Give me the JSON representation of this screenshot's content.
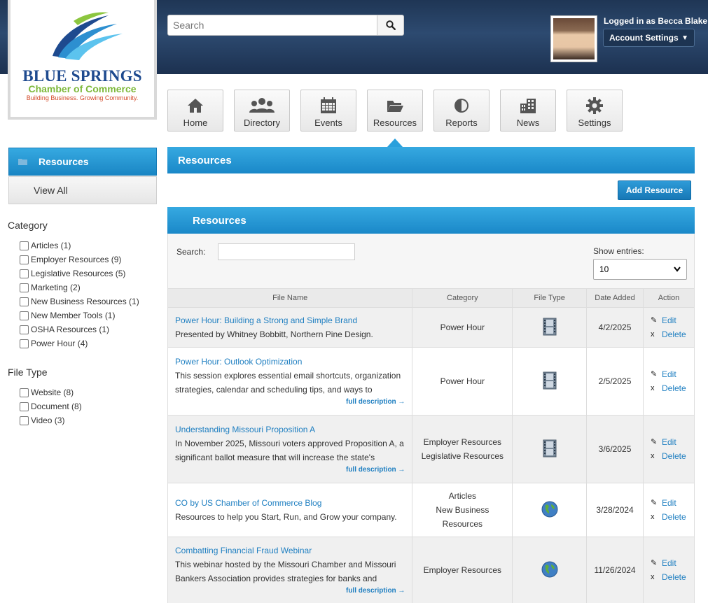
{
  "logo": {
    "title": "BLUE SPRINGS",
    "subtitle": "Chamber of Commerce",
    "tagline": "Building Business. Growing Community."
  },
  "search": {
    "placeholder": "Search"
  },
  "user": {
    "logged_in": "Logged in as Becca Blake",
    "account_label": "Account Settings"
  },
  "nav": [
    {
      "label": "Home",
      "icon": "home-icon"
    },
    {
      "label": "Directory",
      "icon": "people-icon"
    },
    {
      "label": "Events",
      "icon": "calendar-icon"
    },
    {
      "label": "Resources",
      "icon": "folder-icon"
    },
    {
      "label": "Reports",
      "icon": "pie-chart-icon"
    },
    {
      "label": "News",
      "icon": "building-icon"
    },
    {
      "label": "Settings",
      "icon": "gear-icon"
    }
  ],
  "sidebar": {
    "active": "Resources",
    "view_all": "View All",
    "category_heading": "Category",
    "categories": [
      "Articles (1)",
      "Employer Resources (9)",
      "Legislative Resources (5)",
      "Marketing (2)",
      "New Business Resources (1)",
      "New Member Tools (1)",
      "OSHA Resources (1)",
      "Power Hour (4)"
    ],
    "filetype_heading": "File Type",
    "filetypes": [
      "Website (8)",
      "Document (8)",
      "Video (3)"
    ]
  },
  "main": {
    "page_title": "Resources",
    "add_button": "Add Resource",
    "panel_title": "Resources",
    "search_label": "Search:",
    "entries_label": "Show entries:",
    "entries_value": "10"
  },
  "table": {
    "headers": [
      "File Name",
      "Category",
      "File Type",
      "Date Added",
      "Action"
    ],
    "edit": "Edit",
    "delete": "Delete",
    "more": "full description →",
    "rows": [
      {
        "title": "Power Hour: Building a Strong and Simple Brand",
        "desc1": "Presented by Whitney Bobbitt, Northern Pine Design.",
        "desc2": "",
        "more": false,
        "cat": [
          "Power Hour"
        ],
        "type": "video",
        "date": "4/2/2025"
      },
      {
        "title": "Power Hour: Outlook Optimization",
        "desc1": "This session explores essential email shortcuts, organization",
        "desc2": "strategies, calendar and scheduling tips, and ways to",
        "more": true,
        "cat": [
          "Power Hour"
        ],
        "type": "video",
        "date": "2/5/2025"
      },
      {
        "title": "Understanding Missouri Proposition A",
        "desc1": "In November 2025, Missouri voters approved Proposition A, a",
        "desc2": "significant ballot measure that will increase the state's",
        "more": true,
        "cat": [
          "Employer Resources",
          "Legislative Resources"
        ],
        "type": "video",
        "date": "3/6/2025"
      },
      {
        "title": "CO by US Chamber of Commerce Blog",
        "desc1": "Resources to help you Start, Run, and Grow your company.",
        "desc2": "",
        "more": false,
        "cat": [
          "Articles",
          "New Business",
          "Resources"
        ],
        "type": "website",
        "date": "3/28/2024"
      },
      {
        "title": "Combatting Financial Fraud Webinar",
        "desc1": "This webinar hosted by the Missouri Chamber and Missouri",
        "desc2": "Bankers Association provides strategies for banks and",
        "more": true,
        "cat": [
          "Employer Resources"
        ],
        "type": "website",
        "date": "11/26/2024"
      }
    ]
  }
}
